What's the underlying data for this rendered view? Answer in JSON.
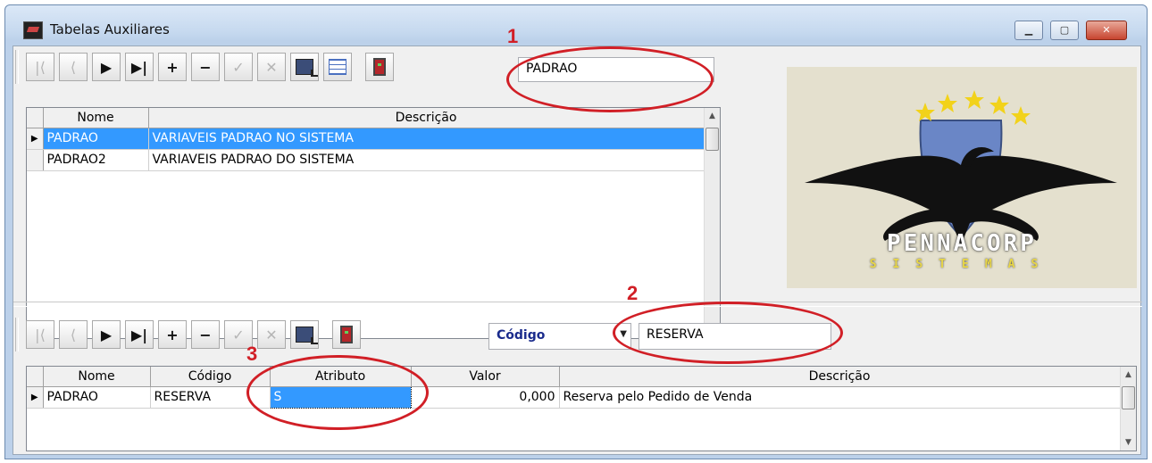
{
  "window": {
    "title": "Tabelas Auxiliares",
    "minimize": "▁",
    "maximize": "▢",
    "close": "✕"
  },
  "top_panel": {
    "search_value": "PADRAO",
    "columns": [
      "Nome",
      "Descrição"
    ],
    "rows": [
      {
        "nome": "PADRAO",
        "descricao": "VARIAVEIS PADRAO NO SISTEMA",
        "selected": true
      },
      {
        "nome": "PADRAO2",
        "descricao": "VARIAVEIS PADRAO DO SISTEMA",
        "selected": false
      }
    ]
  },
  "bottom_panel": {
    "filter_field": "Código",
    "search_value": "RESERVA",
    "columns": [
      "Nome",
      "Código",
      "Atributo",
      "Valor",
      "Descrição"
    ],
    "rows": [
      {
        "nome": "PADRAO",
        "codigo": "RESERVA",
        "atributo": "S",
        "valor": "0,000",
        "descricao": "Reserva pelo Pedido de Venda"
      }
    ]
  },
  "toolbar": {
    "first": "|⟨",
    "prior": "⟨",
    "next": "▶",
    "last": "▶|",
    "insert": "+",
    "delete": "−",
    "edit": "✓",
    "cancel": "✕"
  },
  "logo": {
    "brand": "PENNACORP",
    "sub": "SISTEMAS"
  },
  "annotations": [
    "1",
    "2",
    "3"
  ],
  "colors": {
    "selection": "#3399ff",
    "annotation": "#d11f26",
    "combo_text": "#1a2b8c"
  }
}
